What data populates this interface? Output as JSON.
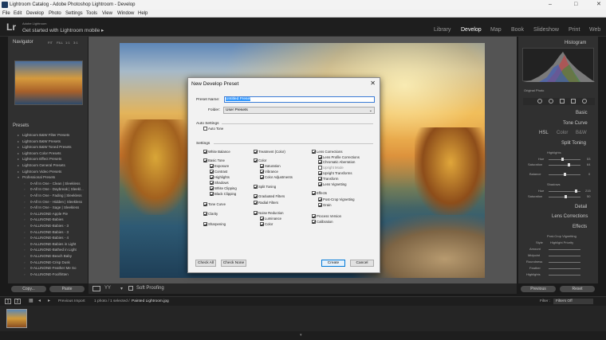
{
  "window": {
    "title": "Lightroom Catalog - Adobe Photoshop Lightroom - Develop",
    "controls": [
      "–",
      "□",
      "✕"
    ]
  },
  "menu": [
    "File",
    "Edit",
    "Develop",
    "Photo",
    "Settings",
    "Tools",
    "View",
    "Window",
    "Help"
  ],
  "identity": {
    "logo": "Lr",
    "user": "Adobe Lightroom",
    "tagline": "Get started with Lightroom mobile",
    "tagline_arrow": "▸"
  },
  "modules": {
    "library": "Library",
    "develop": "Develop",
    "map": "Map",
    "book": "Book",
    "slideshow": "Slideshow",
    "print": "Print",
    "web": "Web"
  },
  "left_panel": {
    "navigator": "Navigator",
    "nav_zoom": [
      "FIT",
      "FILL",
      "1:1",
      "3:1"
    ],
    "presets": "Presets",
    "preset_items": [
      "Lightroom B&W Filter Presets",
      "Lightroom B&W Presets",
      "Lightroom B&W Toned Presets",
      "Lightroom Color Presets",
      "Lightroom Effect Presets",
      "Lightroom General Presets",
      "Lightroom Video Presets",
      "Professional Presets",
      "0-All In One - Clean | Sleekless",
      "0-All In One - Daybreak | Sleekl...",
      "0-All In One - Fading | Sleekless",
      "0-All In One - Hidden | Sleekless",
      "0-All In One - Sage | Sleekless",
      "0-ALLINONE-Apple Pie",
      "0-ALLINONE-Babies",
      "0-ALLINONE-Babies - 3",
      "0-ALLINONE-Babies - 3",
      "0-ALLINONE-Babies - 4",
      "0-ALLINONE-Babies in Light",
      "0-ALLINONE-Bathed in Light",
      "0-ALLINONE-Beach Baby",
      "0-ALLINONE-Crisp Dusk",
      "0-ALLINONE-Feather Me So",
      "0-ALLINONE-Foolfritten"
    ],
    "copy_btn": "Copy...",
    "paste_btn": "Paste"
  },
  "toolbar": {
    "soft_proofing": "Soft Proofing"
  },
  "right_panel": {
    "histogram": "Histogram",
    "original_photo": "Original Photo",
    "basic": "Basic",
    "tone_curve": "Tone Curve",
    "hsl_tabs": [
      "HSL",
      "Color",
      "B&W"
    ],
    "split_toning": "Split Toning",
    "highlights": "Highlights",
    "hue": "Hue",
    "saturation": "Saturation",
    "hl_hue_val": "53",
    "hl_sat_val": "64",
    "balance": "Balance",
    "balance_val": "0",
    "shadows": "Shadows",
    "sh_hue_val": "215",
    "sh_sat_val": "50",
    "detail": "Detail",
    "lens_corrections": "Lens Corrections",
    "effects": "Effects",
    "post_crop": "Post-Crop Vignetting",
    "style": "Style",
    "style_val": "Highlight Priority",
    "amount": "Amount",
    "midpoint": "Midpoint",
    "roundness": "Roundness",
    "feather": "Feather",
    "highlights2": "Highlights",
    "previous_btn": "Previous",
    "reset_btn": "Reset"
  },
  "filmstrip": {
    "pages": [
      "1",
      "2"
    ],
    "previous_import": "Previous Import",
    "info": "1 photo / 1 selected /",
    "filename": "Painted Lightroom.jpg",
    "filter_label": "Filter :",
    "filter_value": "Filters Off"
  },
  "dialog": {
    "title": "New Develop Preset",
    "close": "✕",
    "preset_name_label": "Preset Name:",
    "preset_name_value": "Untitled Preset",
    "folder_label": "Folder:",
    "folder_value": "User Presets",
    "auto_settings": "Auto Settings",
    "auto_tone": "Auto Tone",
    "settings": "Settings",
    "col1": [
      {
        "label": "White Balance",
        "checked": true,
        "indent": 0
      },
      {
        "label": "Basic Tone",
        "checked": true,
        "indent": 0
      },
      {
        "label": "Exposure",
        "checked": true,
        "indent": 1
      },
      {
        "label": "Contrast",
        "checked": true,
        "indent": 1
      },
      {
        "label": "Highlights",
        "checked": true,
        "indent": 1
      },
      {
        "label": "Shadows",
        "checked": true,
        "indent": 1
      },
      {
        "label": "White Clipping",
        "checked": true,
        "indent": 1
      },
      {
        "label": "Black Clipping",
        "checked": true,
        "indent": 1
      },
      {
        "label": "Tone Curve",
        "checked": true,
        "indent": 0
      },
      {
        "label": "Clarity",
        "checked": true,
        "indent": 0
      },
      {
        "label": "Sharpening",
        "checked": true,
        "indent": 0
      }
    ],
    "col2": [
      {
        "label": "Treatment (Color)",
        "checked": true,
        "indent": 0
      },
      {
        "label": "Color",
        "checked": true,
        "indent": 0
      },
      {
        "label": "Saturation",
        "checked": true,
        "indent": 1
      },
      {
        "label": "Vibrance",
        "checked": true,
        "indent": 1
      },
      {
        "label": "Color Adjustments",
        "checked": true,
        "indent": 1
      },
      {
        "label": "Split Toning",
        "checked": true,
        "indent": 0
      },
      {
        "label": "Graduated Filters",
        "checked": true,
        "indent": 0
      },
      {
        "label": "Radial Filters",
        "checked": true,
        "indent": 0
      },
      {
        "label": "Noise Reduction",
        "checked": true,
        "indent": 0
      },
      {
        "label": "Luminance",
        "checked": true,
        "indent": 1
      },
      {
        "label": "Color",
        "checked": true,
        "indent": 1
      }
    ],
    "col3": [
      {
        "label": "Lens Corrections",
        "checked": true,
        "indent": 0
      },
      {
        "label": "Lens Profile Corrections",
        "checked": true,
        "indent": 1
      },
      {
        "label": "Chromatic Aberration",
        "checked": true,
        "indent": 1
      },
      {
        "label": "Upright Mode",
        "checked": false,
        "indent": 1,
        "disabled": true
      },
      {
        "label": "Upright Transforms",
        "checked": true,
        "indent": 1
      },
      {
        "label": "Transform",
        "checked": true,
        "indent": 1
      },
      {
        "label": "Lens Vignetting",
        "checked": true,
        "indent": 1
      },
      {
        "label": "Effects",
        "checked": true,
        "indent": 0
      },
      {
        "label": "Post-Crop Vignetting",
        "checked": true,
        "indent": 1
      },
      {
        "label": "Grain",
        "checked": true,
        "indent": 1
      },
      {
        "label": "Process Version",
        "checked": true,
        "indent": 0
      },
      {
        "label": "Calibration",
        "checked": true,
        "indent": 0
      }
    ],
    "check_all": "Check All",
    "check_none": "Check None",
    "create": "Create",
    "cancel": "Cancel"
  }
}
